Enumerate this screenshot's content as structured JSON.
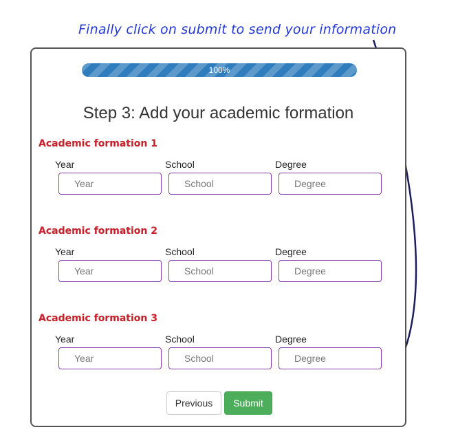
{
  "annotation": {
    "text": "Finally click on submit to send your information",
    "color": "#2337d6"
  },
  "progress": {
    "value": 1.0,
    "label": "100%",
    "color": "#2f7dbd"
  },
  "step_title": "Step 3: Add your academic formation",
  "sections": [
    {
      "title": "Academic formation 1",
      "labels": {
        "year": "Year",
        "school": "School",
        "degree": "Degree"
      },
      "placeholders": {
        "year": "Year",
        "school": "School",
        "degree": "Degree"
      }
    },
    {
      "title": "Academic formation 2",
      "labels": {
        "year": "Year",
        "school": "School",
        "degree": "Degree"
      },
      "placeholders": {
        "year": "Year",
        "school": "School",
        "degree": "Degree"
      }
    },
    {
      "title": "Academic formation 3",
      "labels": {
        "year": "Year",
        "school": "School",
        "degree": "Degree"
      },
      "placeholders": {
        "year": "Year",
        "school": "School",
        "degree": "Degree"
      }
    }
  ],
  "buttons": {
    "previous": "Previous",
    "submit": "Submit",
    "submit_color": "#4cae5b"
  },
  "colors": {
    "section_title": "#c7232e",
    "input_border": "#8a3aa8",
    "arrow": "#1c1d5c"
  }
}
